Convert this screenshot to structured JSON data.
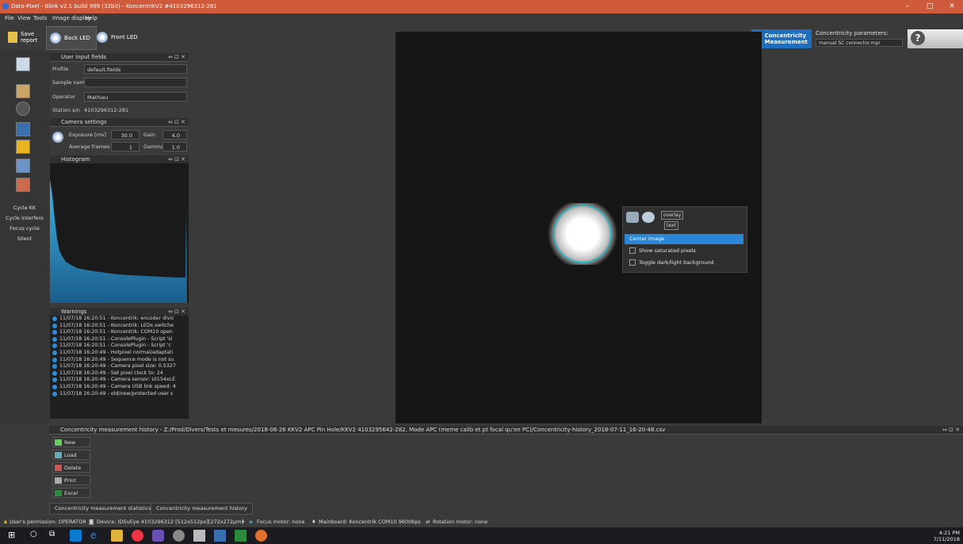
{
  "window": {
    "title": "Data-Pixel - Blink v2.1 build 999 (32bit) - KoncentrikV2 #4103296312-281",
    "min": "–",
    "max": "□",
    "close": "✕"
  },
  "menu": [
    "File",
    "View",
    "Tools",
    "Image display",
    "Help"
  ],
  "toolbar": {
    "save_label": "Save report",
    "back_led": "Back LED",
    "front_led": "Front LED",
    "conc_label": "Concentricity Measurement",
    "conc_params_label": "Concentricity parameters:",
    "conc_params_value": "manual SC connector.mpr",
    "help": "?"
  },
  "sidebar": [
    "Cycle KK",
    "Cycle interfero",
    "Focus cycle",
    "Silent"
  ],
  "user_fields": {
    "header": "User input fields",
    "profile_label": "Profile",
    "profile_value": "default.fields",
    "sample_label": "Sample name",
    "sample_value": "",
    "operator_label": "Operator",
    "operator_value": "Mathieu",
    "station_label": "Station s/n",
    "station_value": "4103296312-281",
    "ctrl": "⇔ ⊡ ✕"
  },
  "camera": {
    "header": "Camera settings",
    "exposure_label": "Exposure [ms]",
    "exposure_value": "30.0",
    "gain_label": "Gain",
    "gain_value": "4.0",
    "avg_label": "Average frames",
    "avg_value": "1",
    "gamma_label": "Gamma",
    "gamma_value": "1.0"
  },
  "histogram": {
    "header": "Histogram"
  },
  "warnings": {
    "header": "Warnings",
    "rows": [
      "11/07/18 16:20:51 - Koncentrik: encoder divic",
      "11/07/18 16:20:51 - Koncentrik: LEDs switche",
      "11/07/18 16:20:51 - Koncentrik: COM10 open",
      "11/07/18 16:20:51 - ConsolePlugin - Script 'si",
      "11/07/18 16:20:51 - ConsolePlugin - Script 'c",
      "11/07/18 16:20:49 - Hotpixel normal/adaptati",
      "11/07/18 16:20:49 - Sequence mode is not su",
      "11/07/18 16:20:49 - Camera pixel size: 0.5327",
      "11/07/18 16:20:49 - Set pixel clock to: 24",
      "11/07/18 16:20:49 - Camera sensor: UI154xLE",
      "11/07/18 16:20:49 - Camera USB link speed: 4",
      "11/07/18 16:20:49 - old/new/protected user s"
    ]
  },
  "overlay": {
    "overlay_btn": "overlay",
    "text_btn": "text",
    "menu": [
      "Center image",
      "Show saturated pixels",
      "Toggle dark/light background"
    ]
  },
  "history": {
    "header": "Concentricity measurement history - Z:/Prod/Divers/Tests et mesures/2018-06-26 KKV2 APC Pin Hole/KKV2 4103295642-282, Mode APC (meme calib et pt focal qu'en PC)/Concentricity-history_2018-07-11_16-20-48.csv",
    "buttons": [
      "New",
      "Load",
      "Delete",
      "Print",
      "Excel"
    ],
    "tabs": [
      "Concentricity measurement statistics",
      "Concentricity measurement history"
    ]
  },
  "status": {
    "permission": "User's permission: OPERATOR",
    "device": "Device: IDSuEye 4103296312 [512x512px][272x272µm]",
    "focus": "Focus motor: none",
    "mainboard": "Mainboard: Koncentrik COM10 9600bps",
    "rotation": "Rotation motor: none"
  },
  "clock": {
    "time": "4:21 PM",
    "date": "7/11/2018"
  },
  "colors": {
    "accent": "#1e6dbf",
    "title": "#cf5a3c",
    "spot_ring": "#1ab7c8",
    "highlight": "#2a86d6"
  }
}
